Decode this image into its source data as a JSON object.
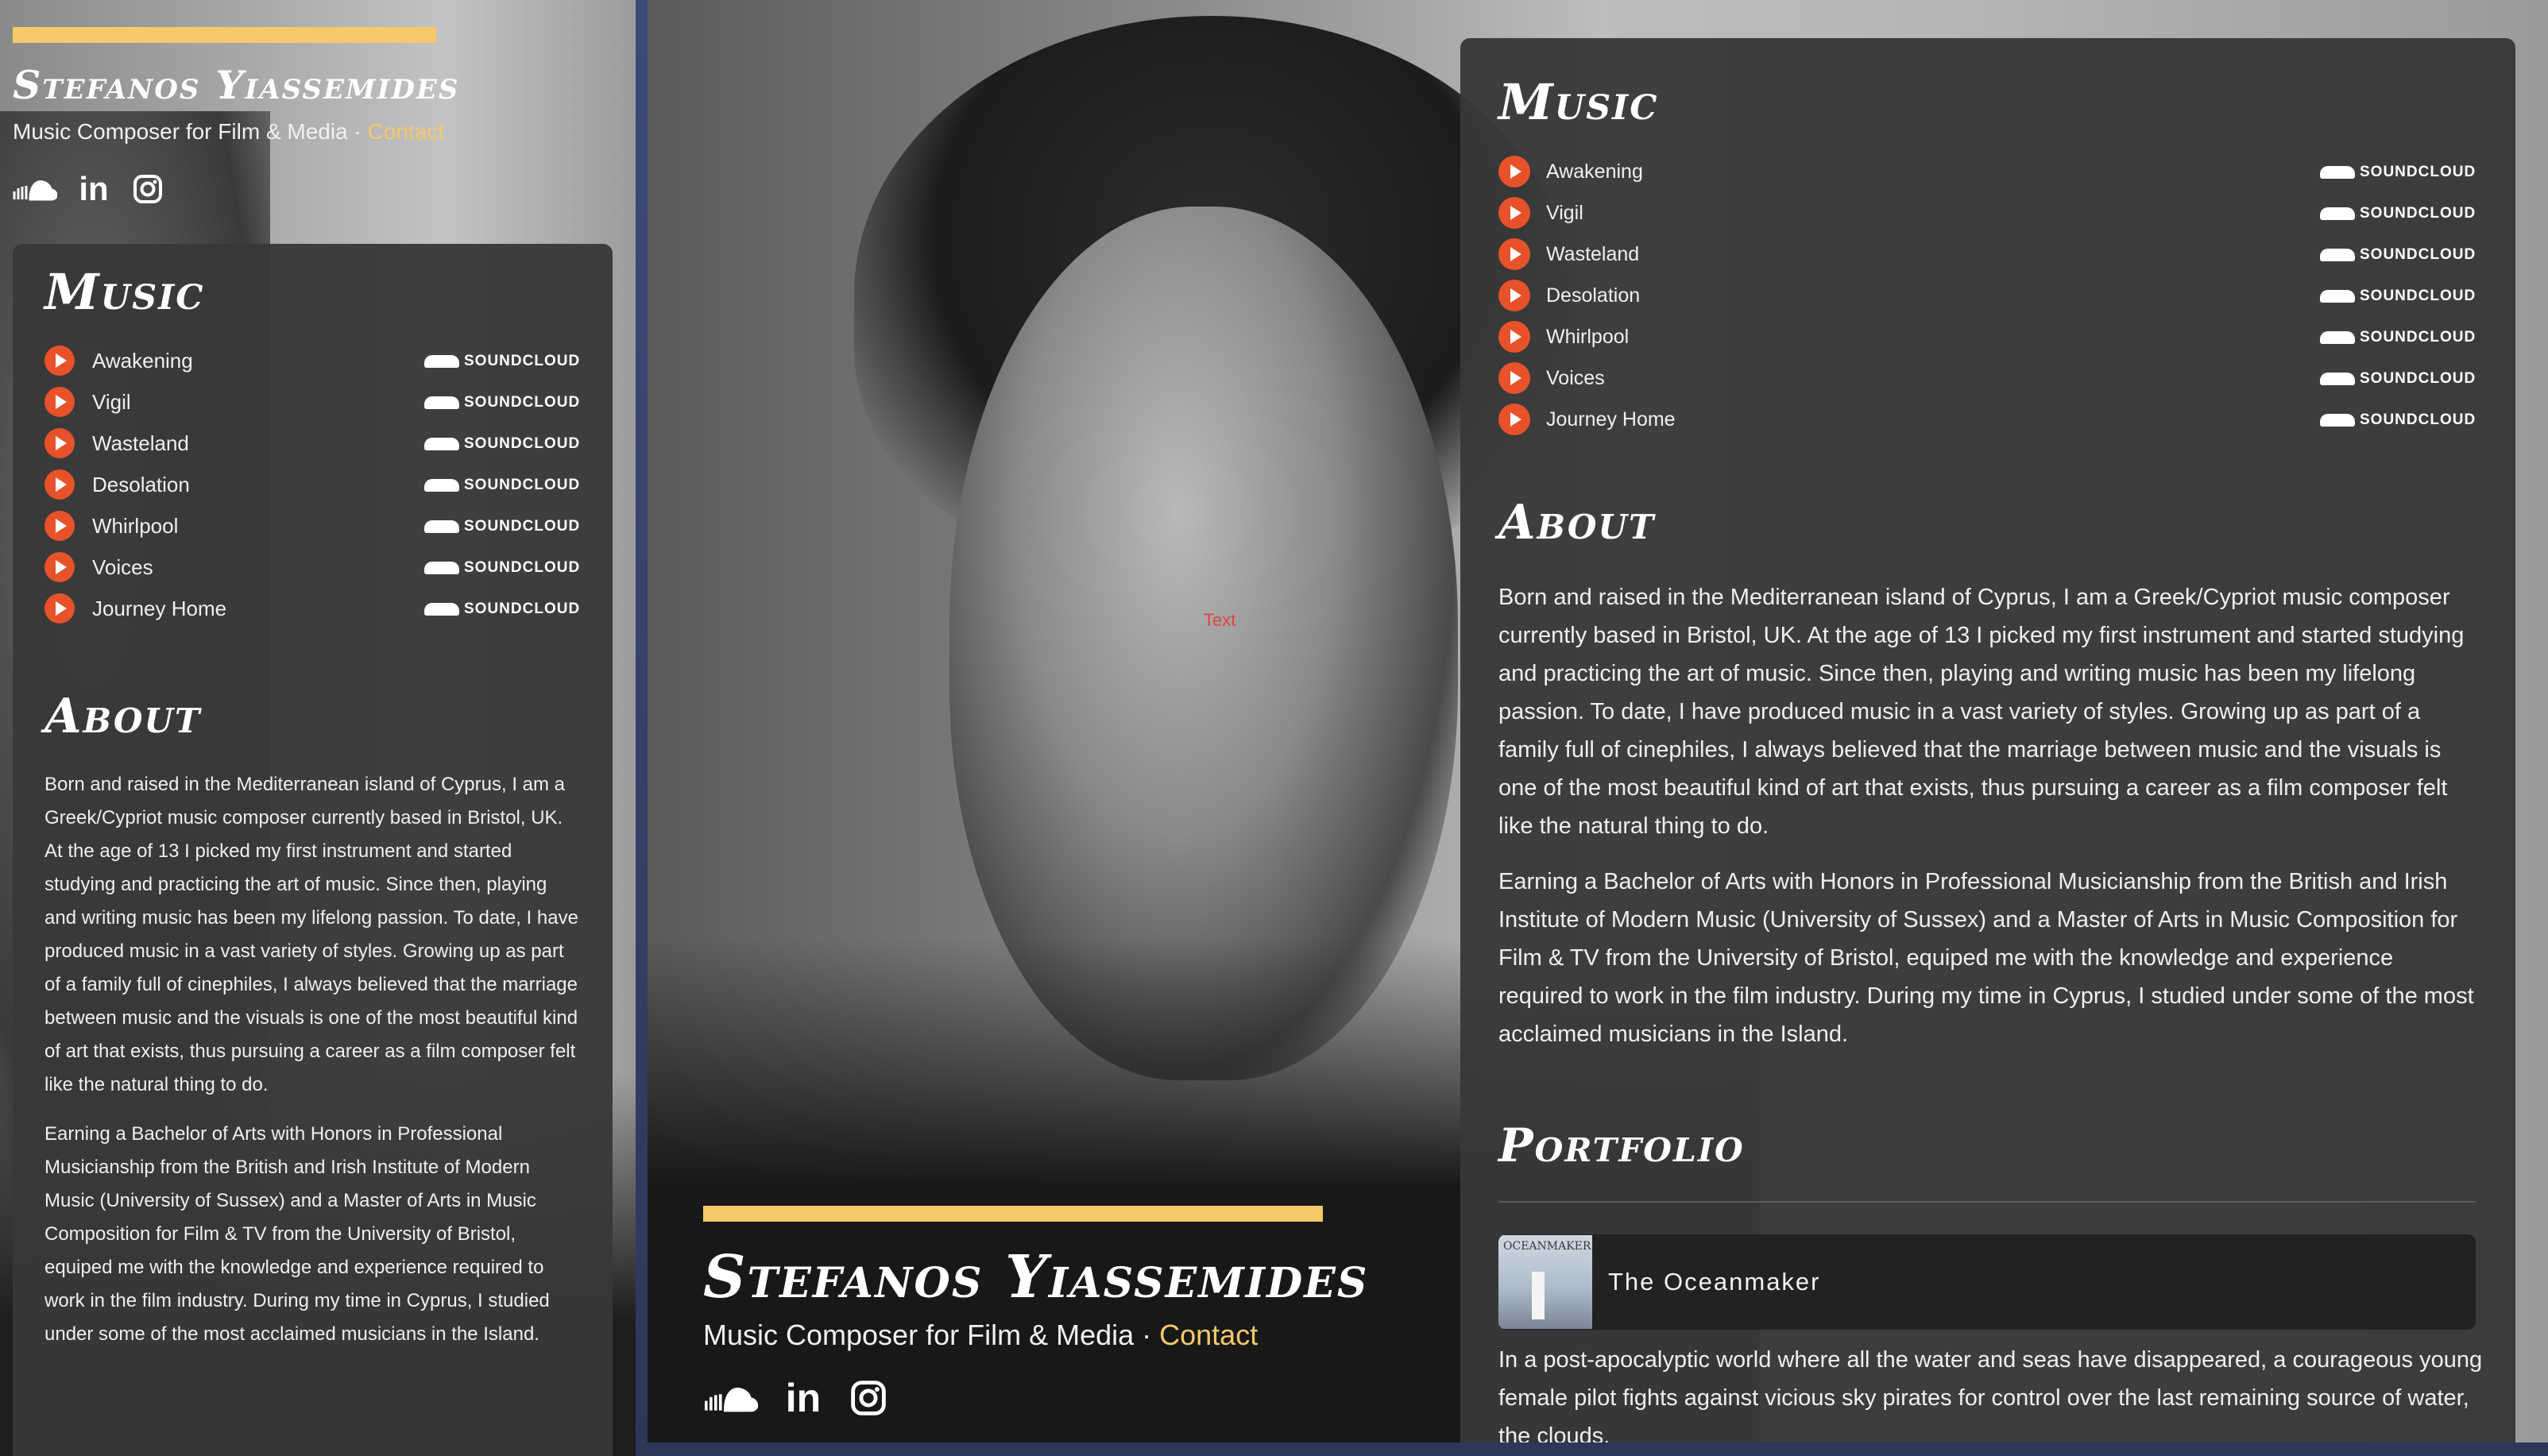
{
  "site": {
    "name": "Stefanos Yiassemides",
    "tagline": "Music Composer for Film & Media",
    "separator": " · ",
    "contact_label": "Contact"
  },
  "socials": [
    {
      "icon": "soundcloud-icon"
    },
    {
      "icon": "linkedin-icon",
      "glyph": "in"
    },
    {
      "icon": "instagram-icon"
    }
  ],
  "music": {
    "heading": "Music",
    "soundcloud_label": "SOUNDCLOUD",
    "tracks": [
      "Awakening",
      "Vigil",
      "Wasteland",
      "Desolation",
      "Whirlpool",
      "Voices",
      "Journey Home"
    ]
  },
  "about": {
    "heading": "About",
    "paragraphs": [
      "Born and raised in the Mediterranean island of Cyprus, I am a Greek/Cypriot music composer currently based in Bristol, UK. At the age of 13 I picked my first instrument and started studying and practicing the art of music. Since then, playing and writing music has been my lifelong passion. To date, I have produced music in a vast variety of styles. Growing up as part of a family full of cinephiles, I always believed that the marriage between music and the visuals is one of the most beautiful kind of art that exists, thus pursuing a career as a film composer felt like the natural thing to do.",
      "Earning a Bachelor of Arts with Honors in Professional Musicianship from the British and Irish Institute of Modern Music (University of Sussex) and a Master of Arts in Music Composition for Film & TV from the University of Bristol, equiped me with the knowledge and experience required to work in the film industry. During my time in Cyprus, I studied under some of the most acclaimed musicians in the Island."
    ]
  },
  "portfolio": {
    "heading": "Portfolio",
    "items": [
      {
        "title": "The Oceanmaker",
        "thumb_logo": "OCEANMAKER",
        "description": "In a post-apocalyptic world where all the water and seas have disappeared, a courageous young female pilot fights against vicious sky pirates for control over the last remaining source of water, the clouds."
      }
    ]
  },
  "debug_marker": "Text",
  "colors": {
    "accent_yellow": "#f6c96a",
    "play_orange": "#e8522a",
    "card_bg": "#383838"
  }
}
